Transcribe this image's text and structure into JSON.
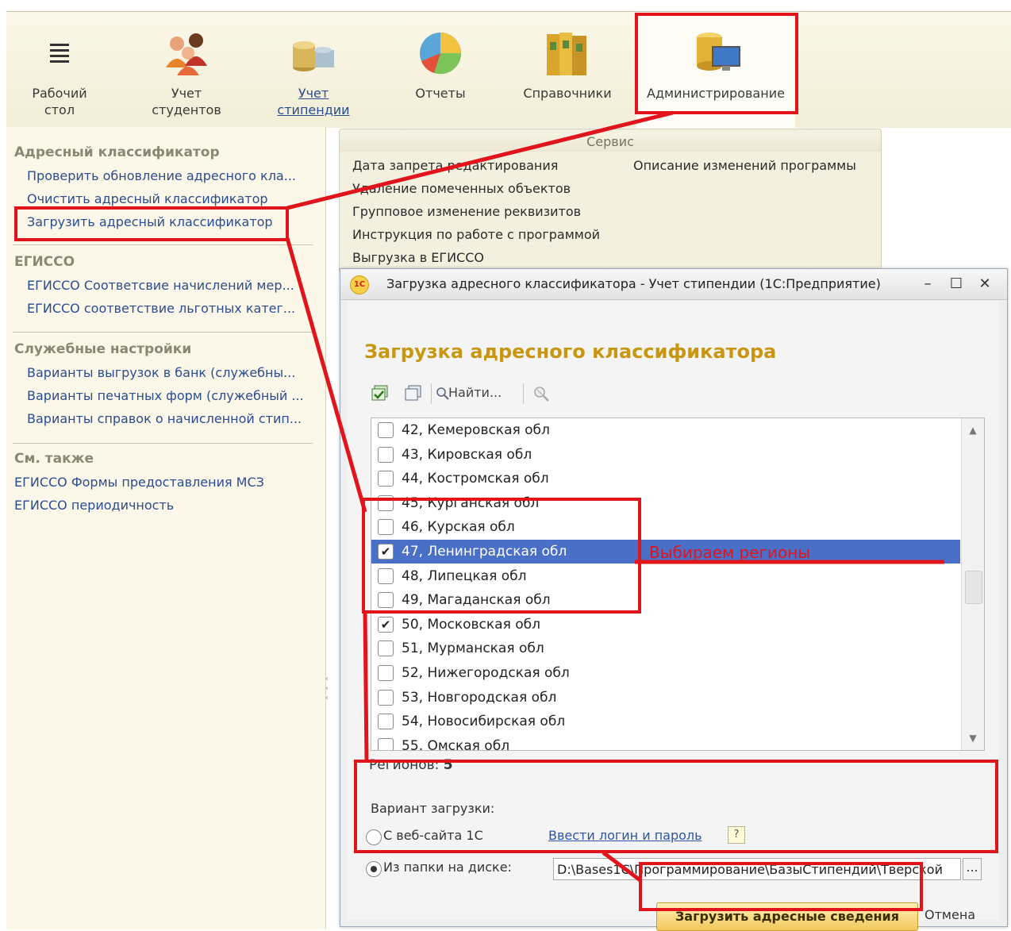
{
  "sections": [
    {
      "label_line1": "Рабочий",
      "label_line2": "стол",
      "icon": "hamburger-icon"
    },
    {
      "label_line1": "Учет",
      "label_line2": "студентов",
      "icon": "people-icon"
    },
    {
      "label_line1": "Учет",
      "label_line2": "стипендии",
      "icon": "coins-icon"
    },
    {
      "label_line1": "Отчеты",
      "label_line2": "",
      "icon": "pie-chart-icon"
    },
    {
      "label_line1": "Справочники",
      "label_line2": "",
      "icon": "binders-icon"
    },
    {
      "label_line1": "Администрирование",
      "label_line2": "",
      "icon": "database-monitor-icon"
    }
  ],
  "leftnav": {
    "group_address": "Адресный классификатор",
    "link_check": "Проверить обновление адресного кла...",
    "link_clear": "Очистить адресный классификатор",
    "link_load": "Загрузить адресный классификатор",
    "group_egisso": "ЕГИССО",
    "link_egisso1": "ЕГИССО Соответсвие начислений мер...",
    "link_egisso2": "ЕГИССО соответствие льготных катег...",
    "group_service": "Служебные настройки",
    "link_svc1": "Варианты выгрузок в банк (служебны...",
    "link_svc2": "Варианты печатных форм (служебный ...",
    "link_svc3": "Варианты справок о начисленной стип...",
    "group_see_also": "См. также",
    "link_see1": "ЕГИССО Формы предоставления МСЗ",
    "link_see2": "ЕГИССО периодичность"
  },
  "service": {
    "title": "Сервис",
    "items": [
      "Дата запрета редактирования",
      "Удаление помеченных объектов",
      "Групповое изменение реквизитов",
      "Инструкция по работе с программой",
      "Выгрузка в ЕГИССО"
    ],
    "right_item": "Описание изменений программы"
  },
  "dialog": {
    "window_title": "Загрузка адресного классификатора - Учет стипендии  (1С:Предприятие)",
    "logo_text": "1С",
    "minimize": "–",
    "maximize": "☐",
    "close": "✕",
    "heading": "Загрузка адресного классификатора",
    "find_label": "Найти...",
    "regions": [
      {
        "label": "42, Кемеровская обл",
        "checked": false,
        "selected": false
      },
      {
        "label": "43, Кировская обл",
        "checked": false,
        "selected": false
      },
      {
        "label": "44, Костромская обл",
        "checked": false,
        "selected": false
      },
      {
        "label": "45, Курганская обл",
        "checked": false,
        "selected": false
      },
      {
        "label": "46, Курская обл",
        "checked": false,
        "selected": false
      },
      {
        "label": "47, Ленинградская обл",
        "checked": true,
        "selected": true
      },
      {
        "label": "48, Липецкая обл",
        "checked": false,
        "selected": false
      },
      {
        "label": "49, Магаданская обл",
        "checked": false,
        "selected": false
      },
      {
        "label": "50, Московская обл",
        "checked": true,
        "selected": false
      },
      {
        "label": "51, Мурманская обл",
        "checked": false,
        "selected": false
      },
      {
        "label": "52, Нижегородская обл",
        "checked": false,
        "selected": false
      },
      {
        "label": "53, Новгородская обл",
        "checked": false,
        "selected": false
      },
      {
        "label": "54, Новосибирская обл",
        "checked": false,
        "selected": false
      },
      {
        "label": "55, Омская обл",
        "checked": false,
        "selected": false
      }
    ],
    "count_label": "Регионов:",
    "count_value": "5",
    "variant_label": "Вариант загрузки:",
    "option_web": "С веб-сайта 1С",
    "option_web_selected": false,
    "login_link": "Ввести логин и пароль",
    "help": "?",
    "option_disk": "Из папки на диске:",
    "option_disk_selected": true,
    "path_value": "D:\\Bases1C\\Программирование\\БазыСтипендий\\Тверской",
    "browse": "...",
    "load_button": "Загрузить адресные сведения",
    "cancel_button": "Отмена"
  },
  "annotation": {
    "text": "Выбираем регионы",
    "color": "#e1141c"
  }
}
